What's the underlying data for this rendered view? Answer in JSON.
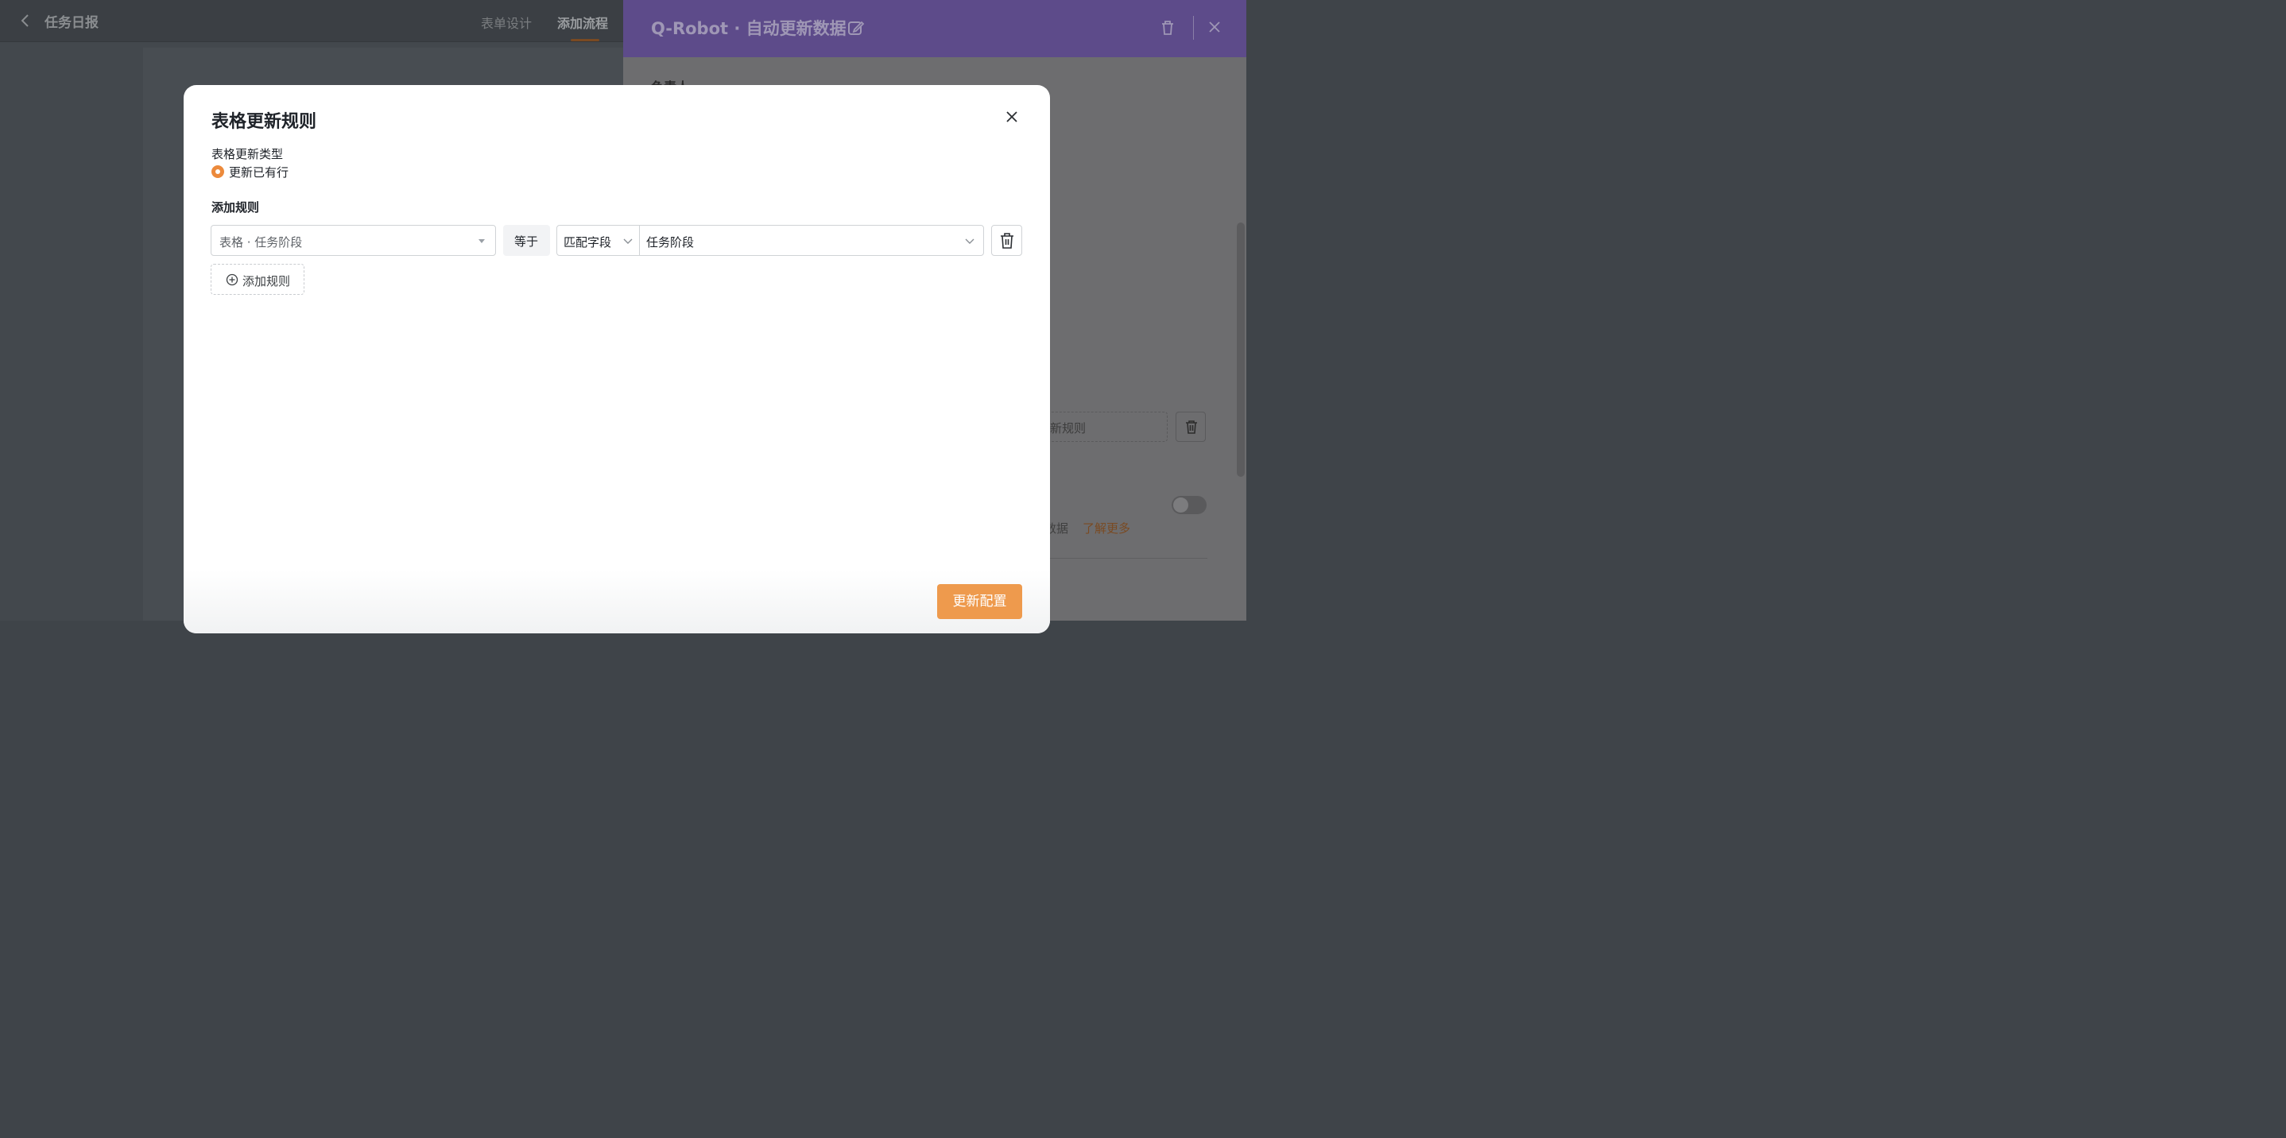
{
  "header": {
    "page_title": "任务日报",
    "tabs": [
      {
        "label": "表单设计",
        "active": false
      },
      {
        "label": "添加流程",
        "active": true
      }
    ]
  },
  "side_panel": {
    "title": "Q-Robot · 自动更新数据",
    "field_label": "负责人",
    "rule_field_text": "新规则",
    "data_text": "数据",
    "learn_more": "了解更多",
    "header_color": "#5d4b8a"
  },
  "modal": {
    "title": "表格更新规则",
    "update_type_label": "表格更新类型",
    "update_type_option": "更新已有行",
    "add_rule_section_label": "添加规则",
    "rule": {
      "field": "表格 · 任务阶段",
      "operator": "等于",
      "match_type": "匹配字段",
      "value": "任务阶段"
    },
    "add_rule_button": "添加规则",
    "submit_button": "更新配置"
  },
  "colors": {
    "accent": "#ee9a4d",
    "radio": "#ec8a3c"
  }
}
